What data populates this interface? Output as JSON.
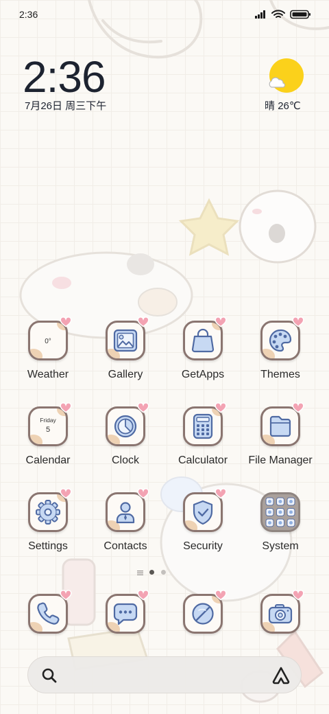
{
  "status_bar": {
    "time": "2:36",
    "signal_icon": "cellular-signal-icon",
    "wifi_icon": "wifi-icon",
    "battery_icon": "battery-icon"
  },
  "clock_widget": {
    "time": "2:36",
    "date": "7月26日 周三下午"
  },
  "weather_widget": {
    "icon": "sun-cloud-icon",
    "condition": "晴",
    "temperature": "26℃"
  },
  "apps": [
    {
      "label": "Weather",
      "icon": "weather-icon",
      "text": "0°"
    },
    {
      "label": "Gallery",
      "icon": "gallery-icon"
    },
    {
      "label": "GetApps",
      "icon": "shopping-bag-icon"
    },
    {
      "label": "Themes",
      "icon": "palette-icon"
    },
    {
      "label": "Calendar",
      "icon": "calendar-icon",
      "weekday": "Friday",
      "day": "5"
    },
    {
      "label": "Clock",
      "icon": "clock-icon"
    },
    {
      "label": "Calculator",
      "icon": "calculator-icon"
    },
    {
      "label": "File Manager",
      "icon": "folder-icon"
    },
    {
      "label": "Settings",
      "icon": "gear-icon"
    },
    {
      "label": "Contacts",
      "icon": "contact-person-icon"
    },
    {
      "label": "Security",
      "icon": "shield-check-icon"
    },
    {
      "label": "System",
      "icon": "app-folder-icon"
    }
  ],
  "page_indicator": {
    "feed_icon": "menu-lines-icon",
    "pages": 2,
    "current_page": 1
  },
  "dock": [
    {
      "icon": "phone-icon"
    },
    {
      "icon": "message-bubble-icon"
    },
    {
      "icon": "browser-icon"
    },
    {
      "icon": "camera-icon"
    }
  ],
  "search_bar": {
    "search_icon": "search-icon",
    "assistant_icon": "app-vault-icon"
  },
  "colors": {
    "icon_border": "#8a7570",
    "glyph_fill": "#c7d9f3",
    "glyph_stroke": "#4f6aa3",
    "heart": "#f3a3b3",
    "sun": "#fbd11b",
    "text": "#222222"
  }
}
